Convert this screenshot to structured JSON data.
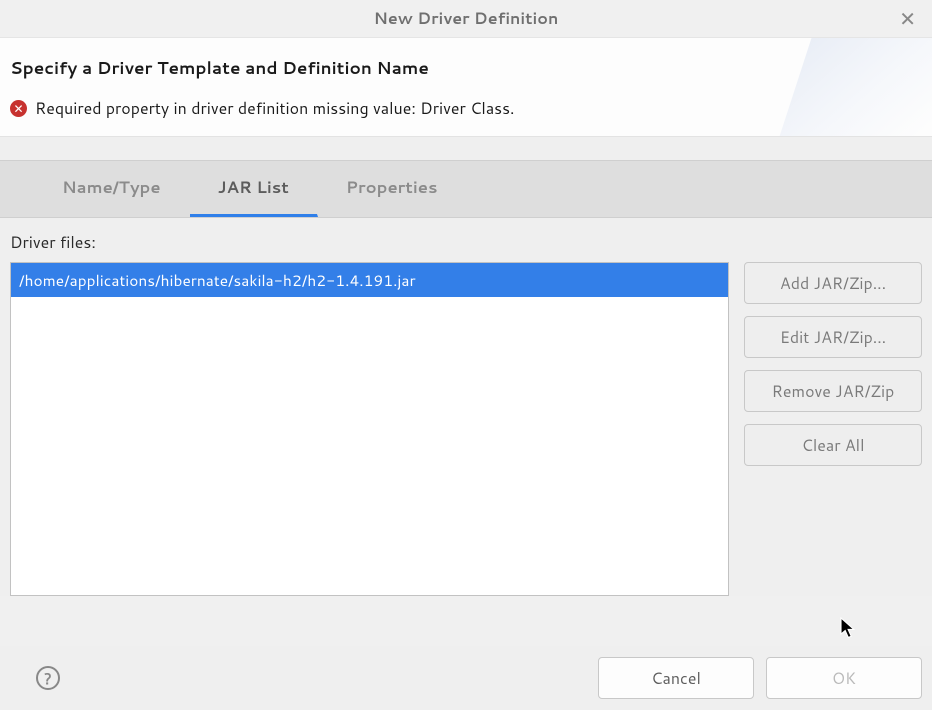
{
  "titlebar": {
    "title": "New Driver Definition"
  },
  "header": {
    "title": "Specify a Driver Template and Definition Name",
    "error": "Required property in driver definition missing value: Driver Class."
  },
  "tabs": {
    "name_type": "Name/Type",
    "jar_list": "JAR List",
    "properties": "Properties"
  },
  "content": {
    "label": "Driver files:",
    "items": [
      "/home/applications/hibernate/sakila-h2/h2-1.4.191.jar"
    ]
  },
  "side_buttons": {
    "add": "Add JAR/Zip...",
    "edit": "Edit JAR/Zip...",
    "remove": "Remove JAR/Zip",
    "clear": "Clear All"
  },
  "footer": {
    "cancel": "Cancel",
    "ok": "OK"
  }
}
